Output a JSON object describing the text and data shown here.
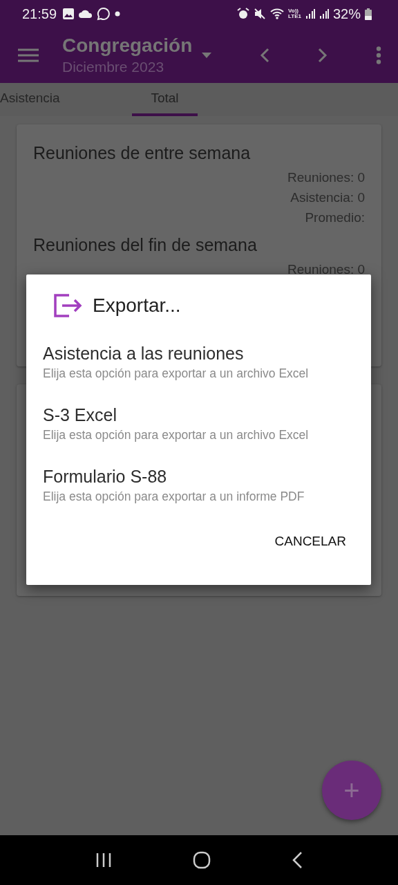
{
  "status_bar": {
    "time": "21:59",
    "network": [
      "Vo))",
      "LTE1"
    ],
    "battery_text": "32%"
  },
  "app_bar": {
    "title": "Congregación",
    "subtitle": "Diciembre 2023"
  },
  "tabs": [
    {
      "label": "Asistencia",
      "selected": false
    },
    {
      "label": "Total",
      "selected": true
    }
  ],
  "card": {
    "sections": [
      {
        "title": "Reuniones de entre semana",
        "stats": [
          "Reuniones: 0",
          "Asistencia: 0",
          "Promedio:"
        ]
      },
      {
        "title": "Reuniones del fin de semana",
        "stats": [
          "Reuniones: 0"
        ]
      }
    ]
  },
  "dialog": {
    "title": "Exportar...",
    "options": [
      {
        "title": "Asistencia a las reuniones",
        "description": "Elija esta opción para exportar a un archivo Excel"
      },
      {
        "title": "S-3 Excel",
        "description": "Elija esta opción para exportar a un archivo Excel"
      },
      {
        "title": "Formulario S-88",
        "description": "Elija esta opción para exportar a un informe PDF"
      }
    ],
    "button": "CANCELAR"
  },
  "fab": {
    "label": "+"
  }
}
